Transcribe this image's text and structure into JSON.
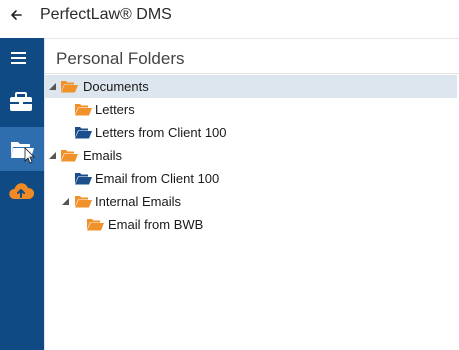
{
  "app": {
    "title": "PerfectLaw® DMS"
  },
  "sidebar": {
    "items": [
      {
        "name": "menu",
        "icon": "hamburger-menu-icon"
      },
      {
        "name": "matters",
        "icon": "briefcase-icon"
      },
      {
        "name": "personal-folders",
        "icon": "open-folder-icon",
        "active": true
      },
      {
        "name": "upload",
        "icon": "cloud-upload-icon"
      }
    ],
    "colors": {
      "background": "#0f4a85",
      "active": "#2e6eae",
      "upload_accent": "#f08a24"
    }
  },
  "panel": {
    "title": "Personal Folders"
  },
  "tree": [
    {
      "label": "Documents",
      "level": 0,
      "expanded": true,
      "folder_color": "orange",
      "selected": true
    },
    {
      "label": "Letters",
      "level": 1,
      "folder_color": "orange"
    },
    {
      "label": "Letters from Client 100",
      "level": 1,
      "folder_color": "blue"
    },
    {
      "label": "Emails",
      "level": 0,
      "expanded": true,
      "folder_color": "orange"
    },
    {
      "label": "Email from Client 100",
      "level": 1,
      "folder_color": "blue"
    },
    {
      "label": "Internal Emails",
      "level": 1,
      "expanded": true,
      "folder_color": "orange"
    },
    {
      "label": "Email from BWB",
      "level": 2,
      "folder_color": "orange"
    }
  ],
  "colors": {
    "folder_orange": "#f0912a",
    "folder_blue": "#1b4f8c",
    "selection": "#dde6ee"
  }
}
